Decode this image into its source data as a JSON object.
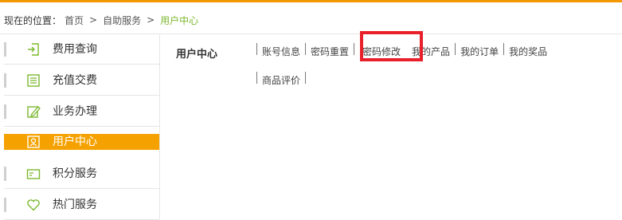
{
  "breadcrumb": {
    "prefix": "现在的位置：",
    "items": [
      "首页",
      "自助服务",
      "用户中心"
    ],
    "separator": ">"
  },
  "sidebar": {
    "items": [
      {
        "label": "费用查询",
        "icon": "login-door-icon"
      },
      {
        "label": "充值交费",
        "icon": "receipt-icon"
      },
      {
        "label": "业务办理",
        "icon": "edit-pen-icon"
      },
      {
        "label": "用户中心",
        "icon": "user-card-icon",
        "active": true
      },
      {
        "label": "积分服务",
        "icon": "card-icon"
      },
      {
        "label": "热门服务",
        "icon": "heart-icon"
      }
    ]
  },
  "main": {
    "title": "用户中心",
    "tabs": [
      {
        "label": "账号信息"
      },
      {
        "label": "密码重置"
      },
      {
        "label": "密码修改",
        "highlighted": true
      },
      {
        "label": "我的产品"
      },
      {
        "label": "我的订单"
      },
      {
        "label": "我的奖品"
      },
      {
        "label": "商品评价"
      }
    ]
  },
  "colors": {
    "accent_orange": "#f5a200",
    "top_bar": "#f39800",
    "icon_green": "#7cb82f",
    "breadcrumb_current": "#7cb82f",
    "highlight_red": "#e8202a"
  }
}
